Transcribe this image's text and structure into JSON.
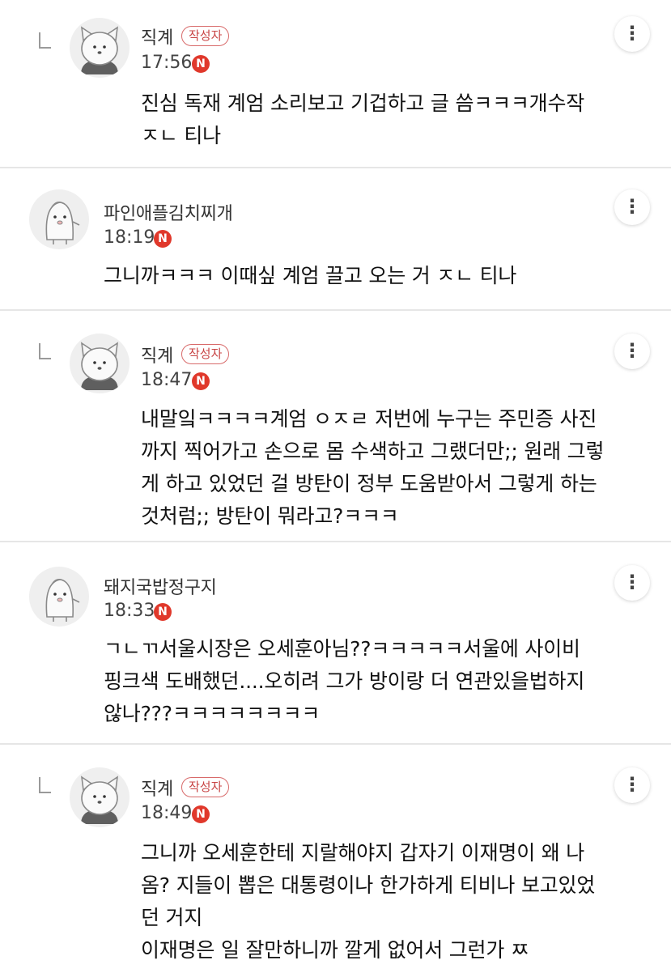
{
  "comments": [
    {
      "author": "직계",
      "badge": "작성자",
      "time": "17:56",
      "new_mark": "N",
      "is_reply": true,
      "avatar_icon": "cat-avatar-icon",
      "more_icon": "⋮",
      "text": "진심 독재 계엄 소리보고 기겁하고 글 씀ㅋㅋㅋ개수작\nㅈㄴ 티나"
    },
    {
      "author": "파인애플김치찌개",
      "badge": "",
      "time": "18:19",
      "new_mark": "N",
      "is_reply": false,
      "avatar_icon": "pig-avatar-icon",
      "more_icon": "⋮",
      "text": "그니까ㅋㅋㅋ 이때싶 계엄 끌고 오는 거 ㅈㄴ 티나"
    },
    {
      "author": "직계",
      "badge": "작성자",
      "time": "18:47",
      "new_mark": "N",
      "is_reply": true,
      "avatar_icon": "cat-avatar-icon",
      "more_icon": "⋮",
      "text": "내말잌ㅋㅋㅋㅋ계엄 ㅇㅈㄹ 저번에 누구는 주민증 사진\n까지 찍어가고 손으로 몸 수색하고 그랬더만;; 원래 그렇\n게 하고 있었던 걸 방탄이 정부 도움받아서 그렇게 하는\n것처럼;; 방탄이 뭐라고?ㅋㅋㅋ"
    },
    {
      "author": "돼지국밥정구지",
      "badge": "",
      "time": "18:33",
      "new_mark": "N",
      "is_reply": false,
      "avatar_icon": "pig-avatar-icon",
      "more_icon": "⋮",
      "text": "ㄱㄴㄲ서울시장은 오세훈아님??ㅋㅋㅋㅋㅋ서울에 사이비\n핑크색 도배했던....오히려 그가 방이랑 더 연관있을법하지\n않나???ㅋㅋㅋㅋㅋㅋㅋㅋ"
    },
    {
      "author": "직계",
      "badge": "작성자",
      "time": "18:49",
      "new_mark": "N",
      "is_reply": true,
      "avatar_icon": "cat-avatar-icon",
      "more_icon": "⋮",
      "text": "그니까 오세훈한테 지랄해야지 갑자기 이재명이 왜 나\n옴? 지들이 뽑은 대통령이나 한가하게 티비나 보고있었\n던 거지\n이재명은 일 잘만하니까 깔게 없어서 그런가 ㅉ"
    }
  ]
}
